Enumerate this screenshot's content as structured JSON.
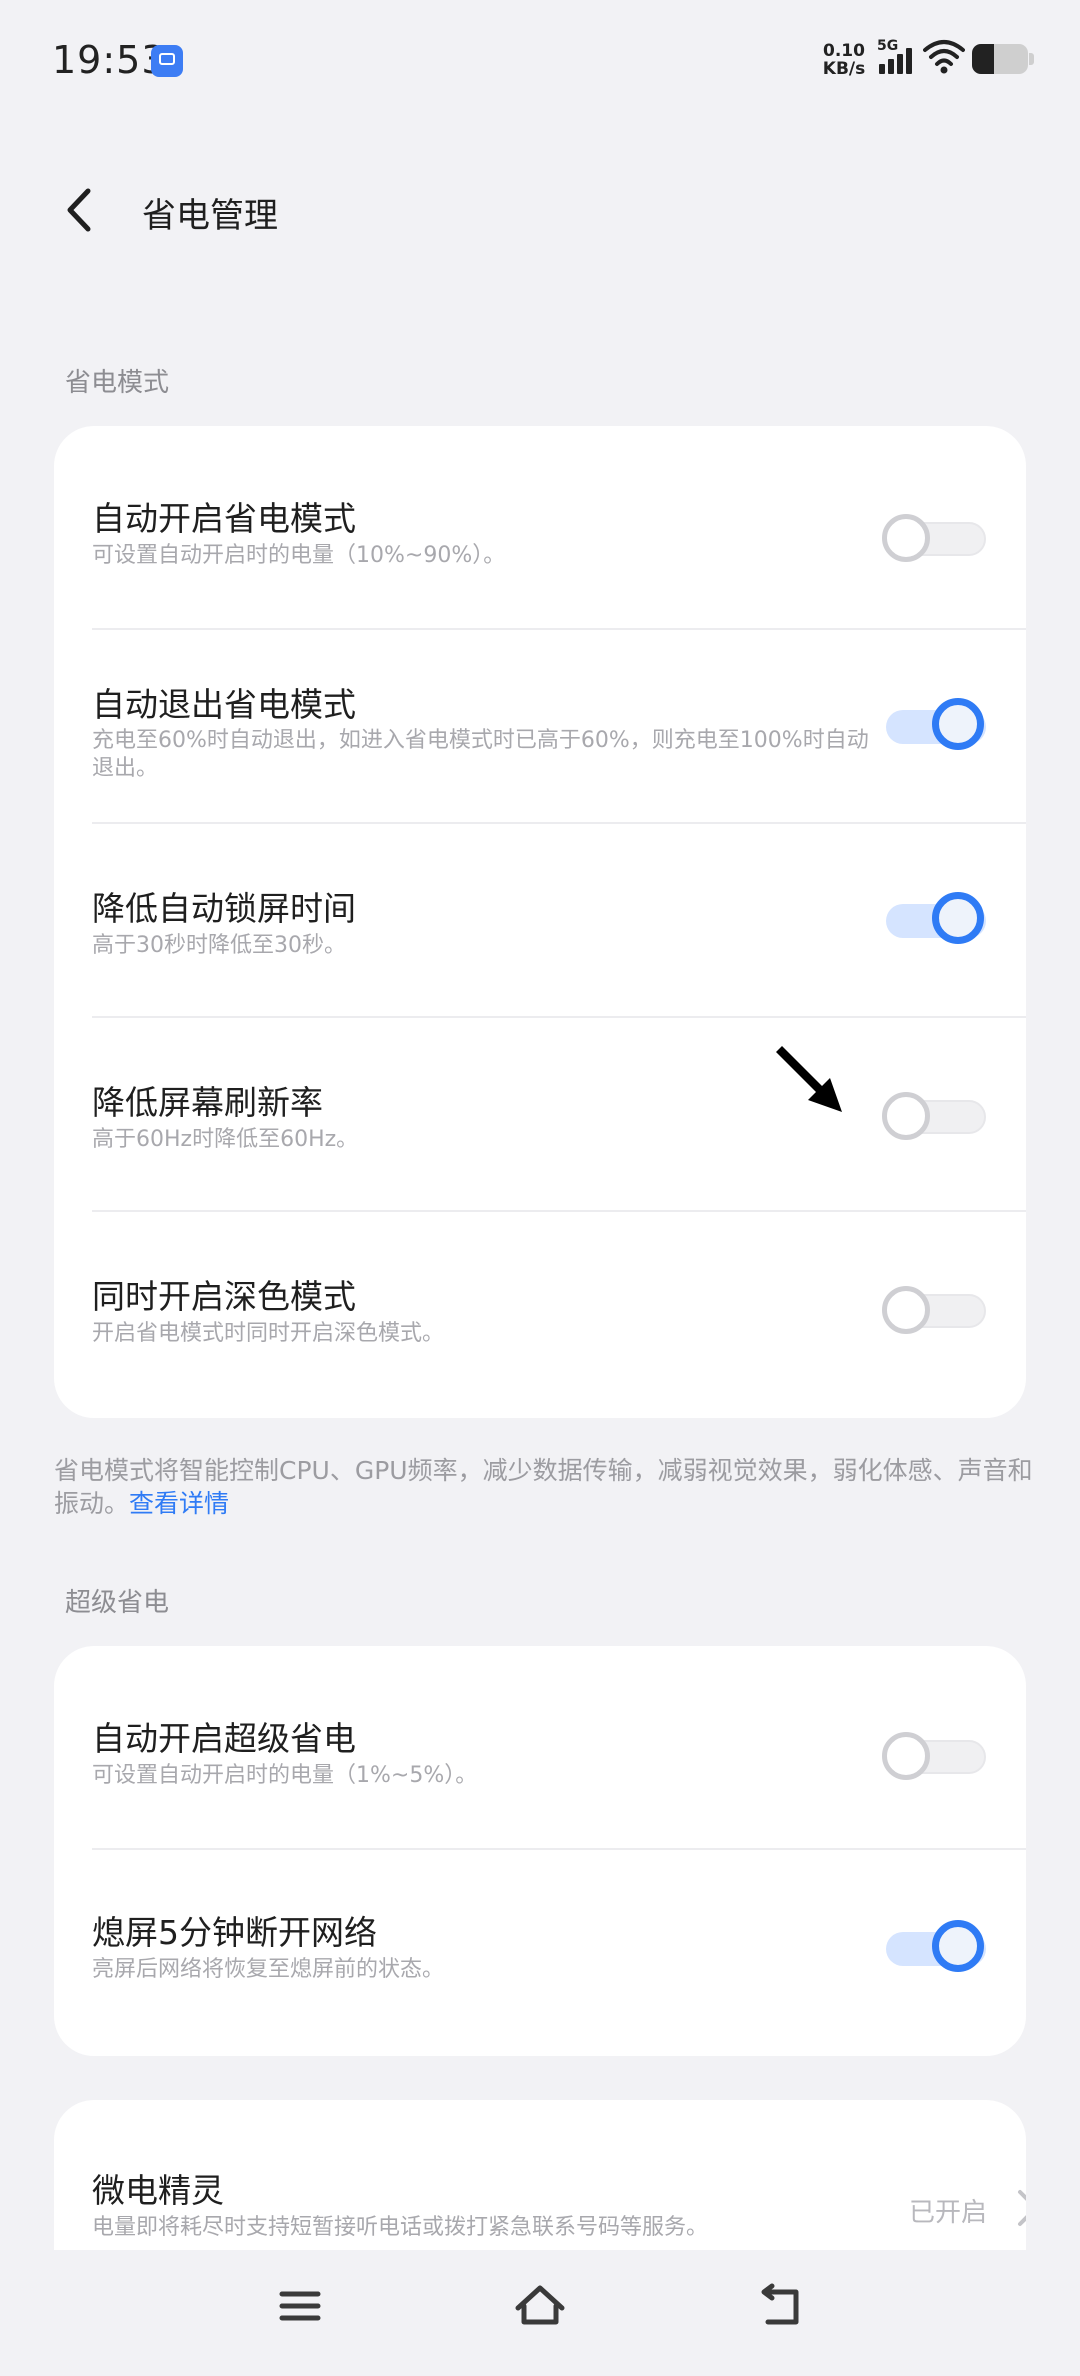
{
  "status_bar": {
    "time": "19:53",
    "net_speed_value": "0.10",
    "net_speed_unit": "KB/s",
    "network_type": "5G",
    "battery_percent": 40
  },
  "header": {
    "title": "省电管理"
  },
  "power_saving": {
    "section_label": "省电模式",
    "items": [
      {
        "title": "自动开启省电模式",
        "subtitle": "可设置自动开启时的电量（10%~90%）。",
        "enabled": false
      },
      {
        "title": "自动退出省电模式",
        "subtitle": "充电至60%时自动退出，如进入省电模式时已高于60%，则充电至100%时自动退出。",
        "enabled": true
      },
      {
        "title": "降低自动锁屏时间",
        "subtitle": "高于30秒时降低至30秒。",
        "enabled": true
      },
      {
        "title": "降低屏幕刷新率",
        "subtitle": "高于60Hz时降低至60Hz。",
        "enabled": false
      },
      {
        "title": "同时开启深色模式",
        "subtitle": "开启省电模式时同时开启深色模式。",
        "enabled": false
      }
    ],
    "note": "省电模式将智能控制CPU、GPU频率，减少数据传输，减弱视觉效果，弱化体感、声音和振动。",
    "note_link": "查看详情"
  },
  "super_saving": {
    "section_label": "超级省电",
    "items": [
      {
        "title": "自动开启超级省电",
        "subtitle": "可设置自动开启时的电量（1%~5%）。",
        "enabled": false
      },
      {
        "title": "熄屏5分钟断开网络",
        "subtitle": "亮屏后网络将恢复至熄屏前的状态。",
        "enabled": true
      }
    ]
  },
  "micro_power": {
    "title": "微电精灵",
    "subtitle": "电量即将耗尽时支持短暂接听电话或拨打紧急联系号码等服务。",
    "value": "已开启"
  },
  "colors": {
    "accent": "#2f7bf5",
    "background": "#f2f2f5",
    "card": "#ffffff"
  }
}
